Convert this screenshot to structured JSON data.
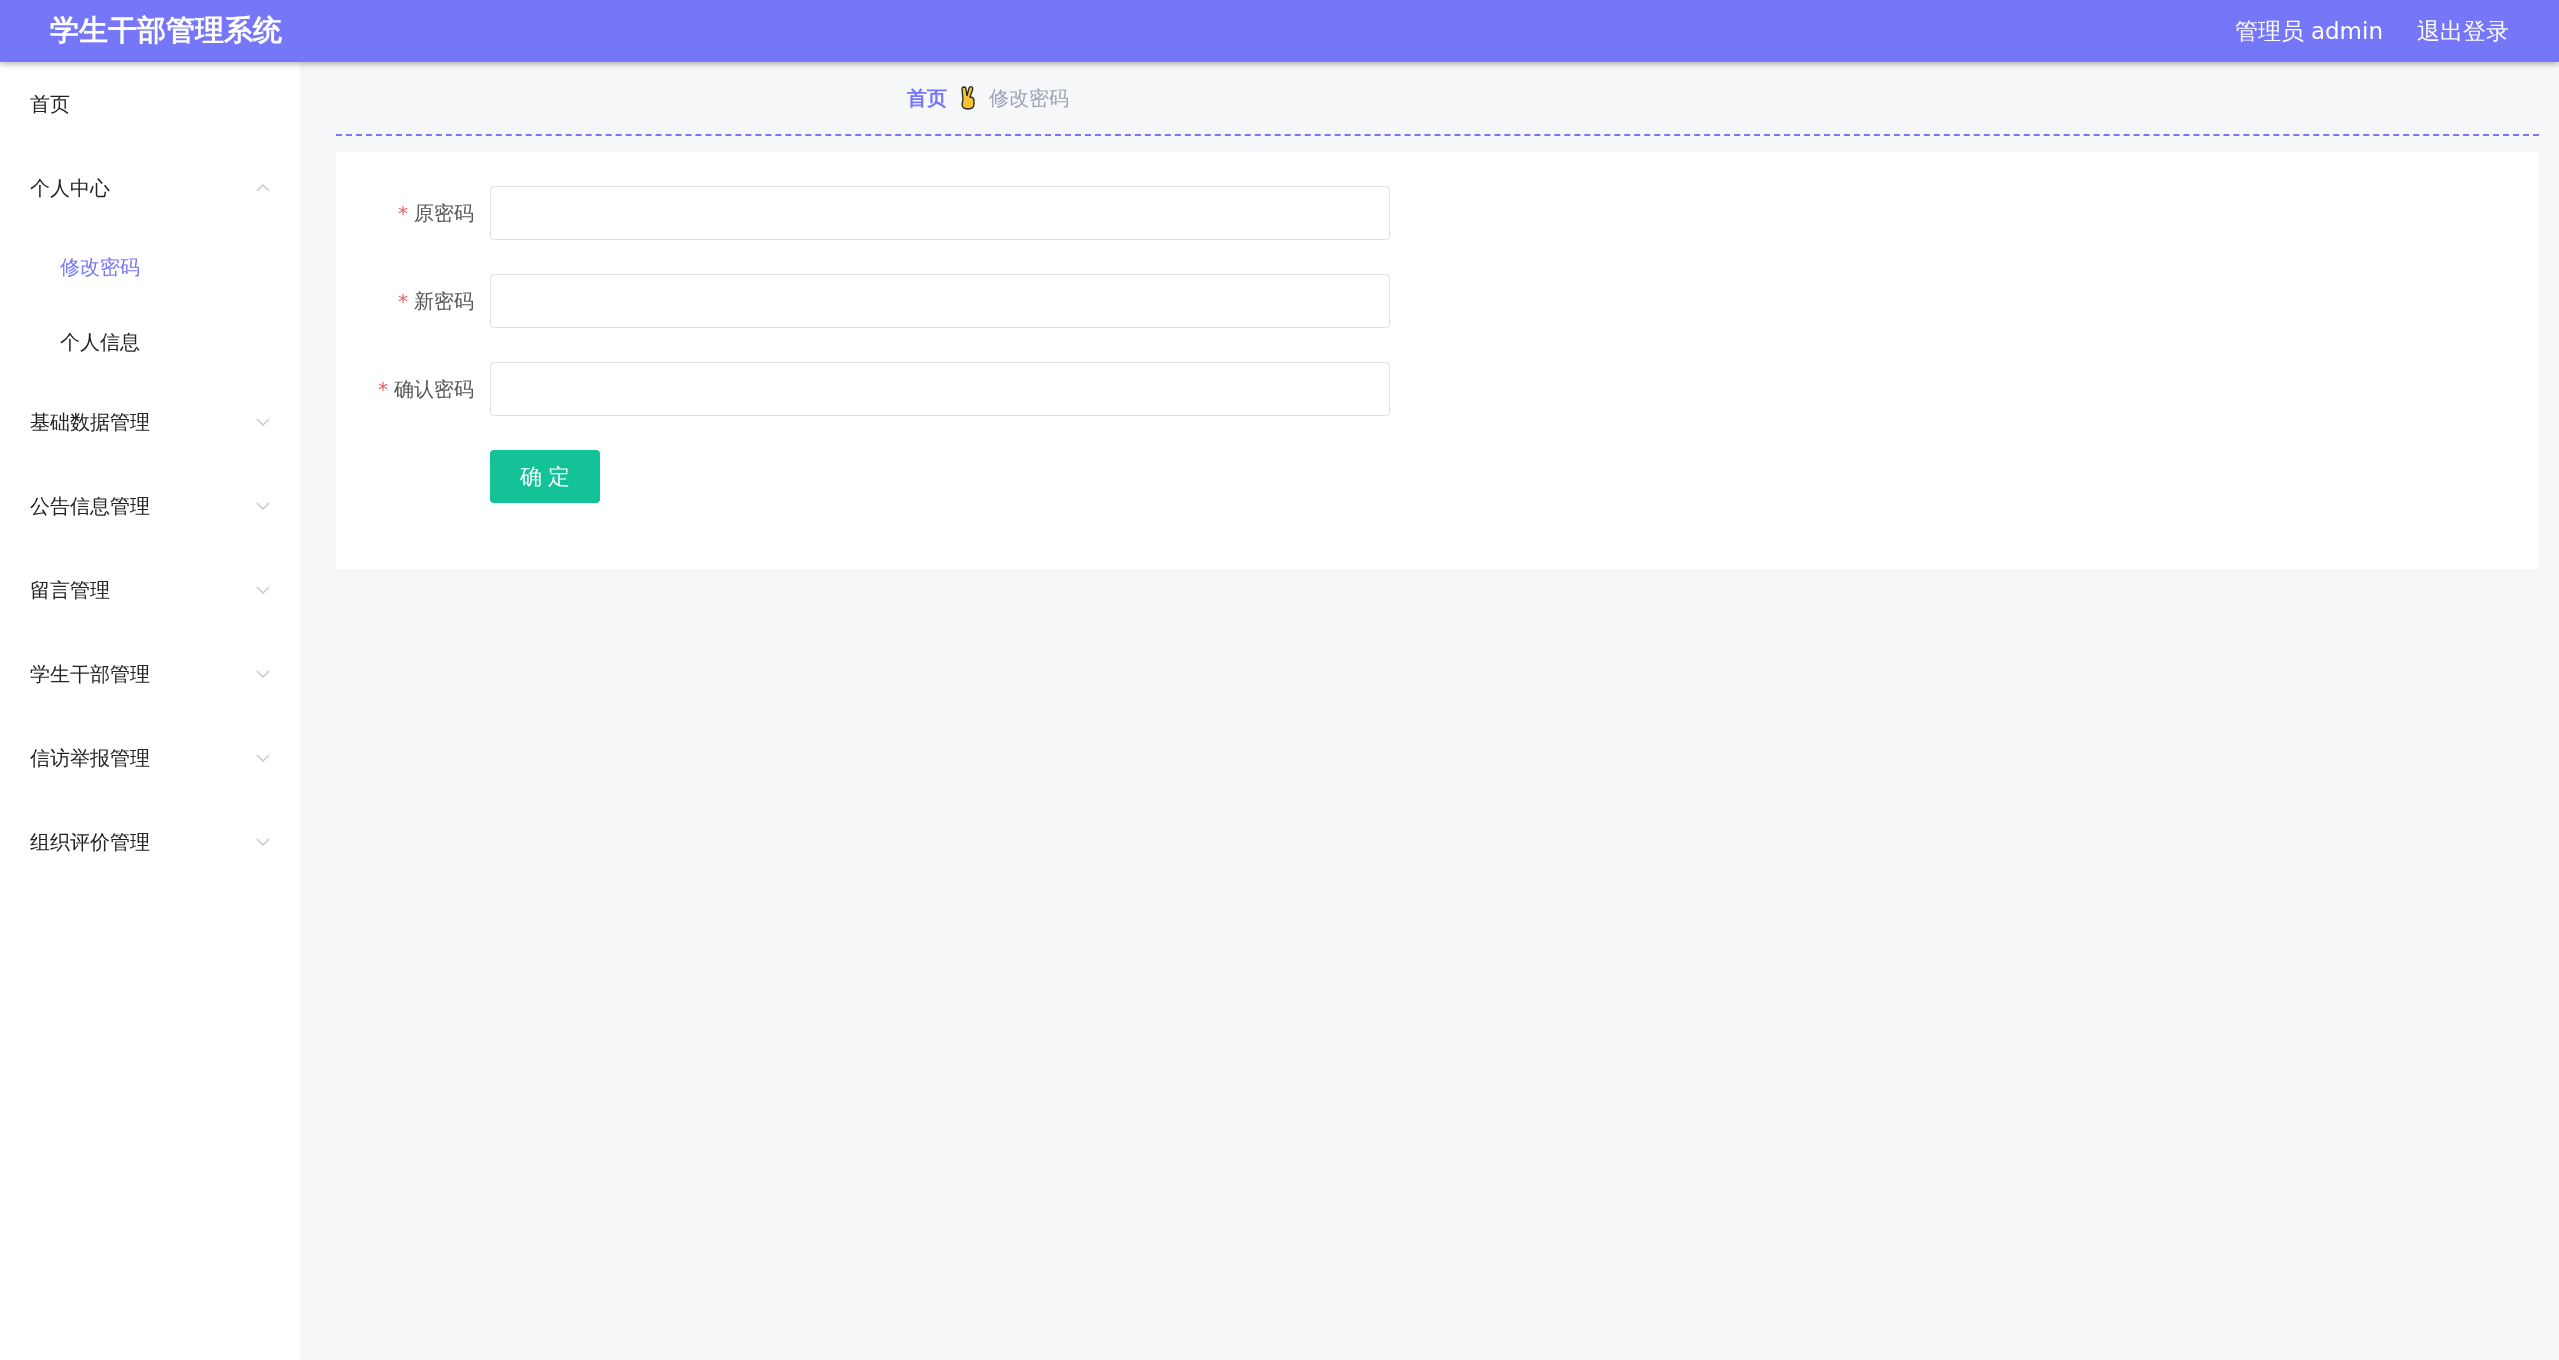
{
  "header": {
    "title": "学生干部管理系统",
    "user": "管理员 admin",
    "logout": "退出登录"
  },
  "sidebar": {
    "items": [
      {
        "label": "首页",
        "kind": "link",
        "selected": false
      },
      {
        "label": "个人中心",
        "kind": "group",
        "expanded": true,
        "children": [
          {
            "label": "修改密码",
            "selected": true
          },
          {
            "label": "个人信息",
            "selected": false
          }
        ]
      },
      {
        "label": "基础数据管理",
        "kind": "group",
        "expanded": false
      },
      {
        "label": "公告信息管理",
        "kind": "group",
        "expanded": false
      },
      {
        "label": "留言管理",
        "kind": "group",
        "expanded": false
      },
      {
        "label": "学生干部管理",
        "kind": "group",
        "expanded": false
      },
      {
        "label": "信访举报管理",
        "kind": "group",
        "expanded": false
      },
      {
        "label": "组织评价管理",
        "kind": "group",
        "expanded": false
      }
    ]
  },
  "breadcrumb": [
    {
      "label": "首页",
      "selected": true
    },
    {
      "label": "修改密码",
      "selected": false
    }
  ],
  "form": {
    "fields": [
      {
        "label": "原密码",
        "required": true,
        "required_mark": "*"
      },
      {
        "label": "新密码",
        "required": true,
        "required_mark": "*"
      },
      {
        "label": "确认密码",
        "required": true,
        "required_mark": "*"
      }
    ],
    "submit": "确 定"
  }
}
